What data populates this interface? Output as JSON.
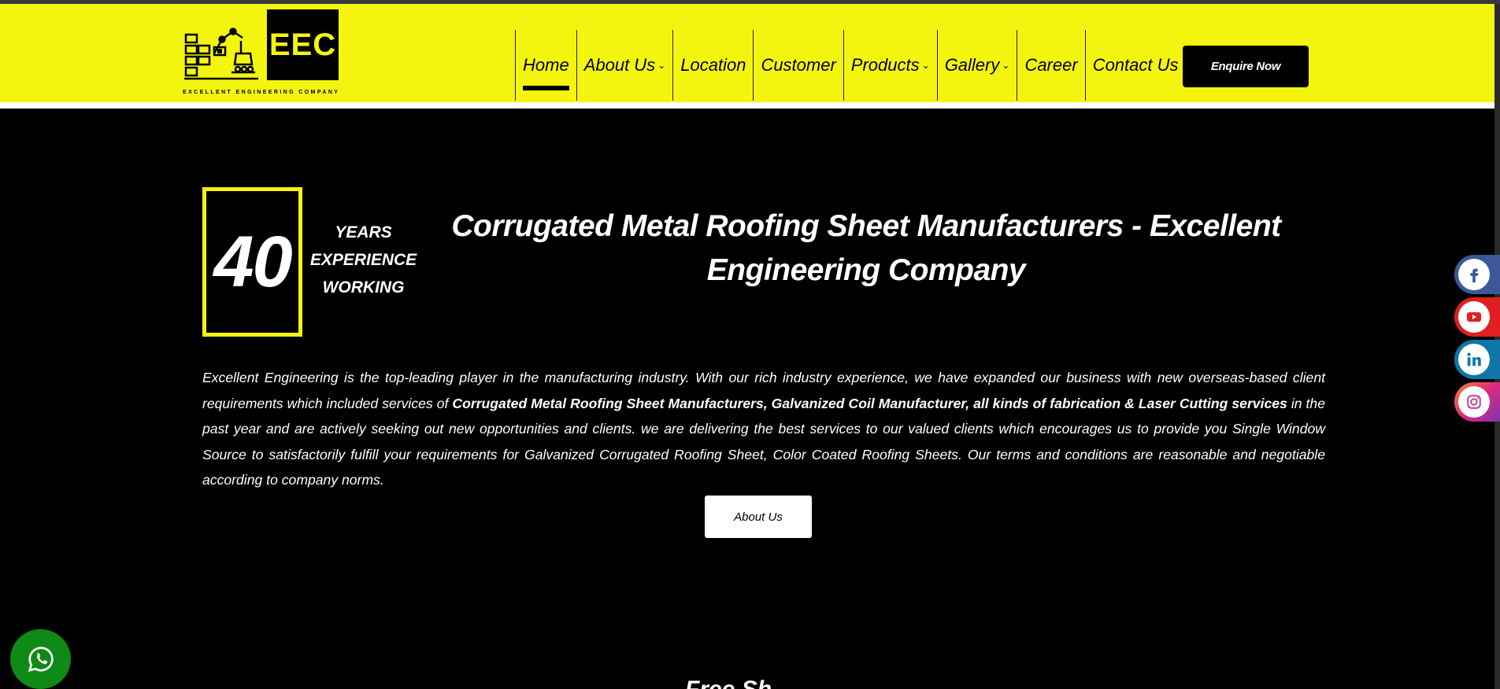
{
  "header": {
    "logo_text": "EEC",
    "logo_tagline": "EXCELLENT ENGINEERING COMPANY",
    "brand_color": "#f4f50f"
  },
  "nav": {
    "items": [
      {
        "label": "Home",
        "active": true,
        "dropdown": false
      },
      {
        "label": "About Us",
        "active": false,
        "dropdown": true
      },
      {
        "label": "Location",
        "active": false,
        "dropdown": false
      },
      {
        "label": "Customer",
        "active": false,
        "dropdown": false
      },
      {
        "label": "Products",
        "active": false,
        "dropdown": true
      },
      {
        "label": "Gallery",
        "active": false,
        "dropdown": true
      },
      {
        "label": "Career",
        "active": false,
        "dropdown": false
      },
      {
        "label": "Contact Us",
        "active": false,
        "dropdown": false
      }
    ],
    "enquire_label": "Enquire Now"
  },
  "experience": {
    "years": "40",
    "line1": "YEARS",
    "line2": "EXPERIENCE",
    "line3": "WORKING"
  },
  "hero": {
    "title": "Corrugated Metal Roofing Sheet Manufacturers - Excellent Engineering Company",
    "para_part1": "Excellent Engineering is the top-leading player in the manufacturing industry. With our rich industry experience, we have expanded our business with new overseas-based client requirements which included services of ",
    "para_bold": "Corrugated Metal Roofing Sheet Manufacturers, Galvanized Coil Manufacturer, all kinds of fabrication & Laser Cutting services",
    "para_part2": " in the past year and are actively seeking out new opportunities and clients. we are delivering the best services to our valued clients which encourages us to provide you Single Window Source to satisfactorily fulfill your requirements for Galvanized Corrugated Roofing Sheet, Color Coated Roofing Sheets. Our terms and conditions are reasonable and negotiable according to company norms.",
    "about_button": "About Us"
  },
  "social": [
    {
      "icon": "facebook-icon",
      "glyph": "f",
      "color": "#3b5998"
    },
    {
      "icon": "youtube-icon",
      "glyph": "You Tube",
      "color": "#e02020"
    },
    {
      "icon": "linkedin-icon",
      "glyph": "in",
      "color": "#0e76a8"
    },
    {
      "icon": "instagram-icon",
      "glyph": "ig",
      "color": "#dd2a7b"
    }
  ],
  "whatsapp": {
    "icon": "whatsapp-icon",
    "color": "#0e8a16"
  },
  "next_section_peek": "Free Sh"
}
